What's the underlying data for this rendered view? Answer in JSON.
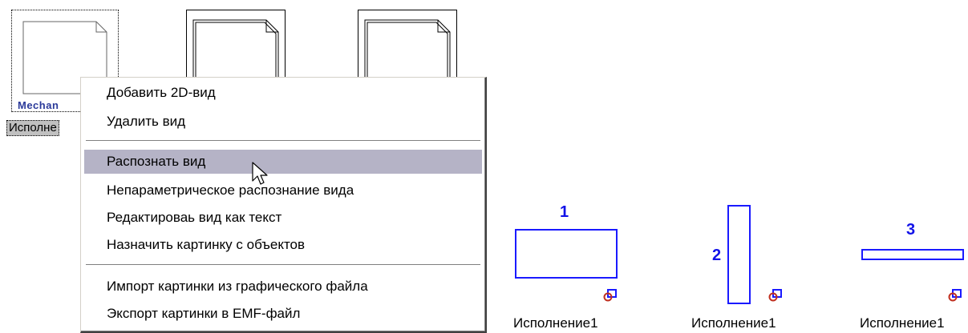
{
  "thumbnails": [
    {
      "label": "Mechan",
      "caption": "Исполне",
      "selected": true
    },
    {
      "caption": "",
      "selected": false
    },
    {
      "caption": "",
      "selected": false
    }
  ],
  "context_menu": {
    "groups": [
      [
        "Добавить 2D-вид",
        "Удалить вид"
      ],
      [
        "Распознать вид",
        "Непараметрическое распознание вида",
        "Редактироваь вид как текст",
        "Назначить картинку с объектов"
      ],
      [
        "Импорт картинки из графического файла",
        "Экспорт картинки в EMF-файл"
      ]
    ],
    "items": {
      "add_2d_view": "Добавить 2D-вид",
      "delete_view": "Удалить вид",
      "recognize_view": "Распознать вид",
      "nonparam_recognize": "Непараметрическое распознание вида",
      "edit_as_text": "Редактироваь вид как текст",
      "assign_picture": "Назначить картинку с объектов",
      "import_picture": "Импорт картинки из графического файла",
      "export_emf": "Экспорт картинки в EMF-файл"
    },
    "highlighted": "Распознать вид"
  },
  "figures": [
    {
      "number": "1",
      "caption": "Исполнение1",
      "shape": "wide-rectangle"
    },
    {
      "number": "2",
      "caption": "Исполнение1",
      "shape": "tall-rectangle"
    },
    {
      "number": "3",
      "caption": "Исполнение1",
      "shape": "flat-rectangle"
    }
  ],
  "colors": {
    "shape_stroke": "#1a1aff",
    "number_text": "#1212e8",
    "menu_highlight": "#b5b3c6",
    "mini_icon": "#c03020"
  }
}
